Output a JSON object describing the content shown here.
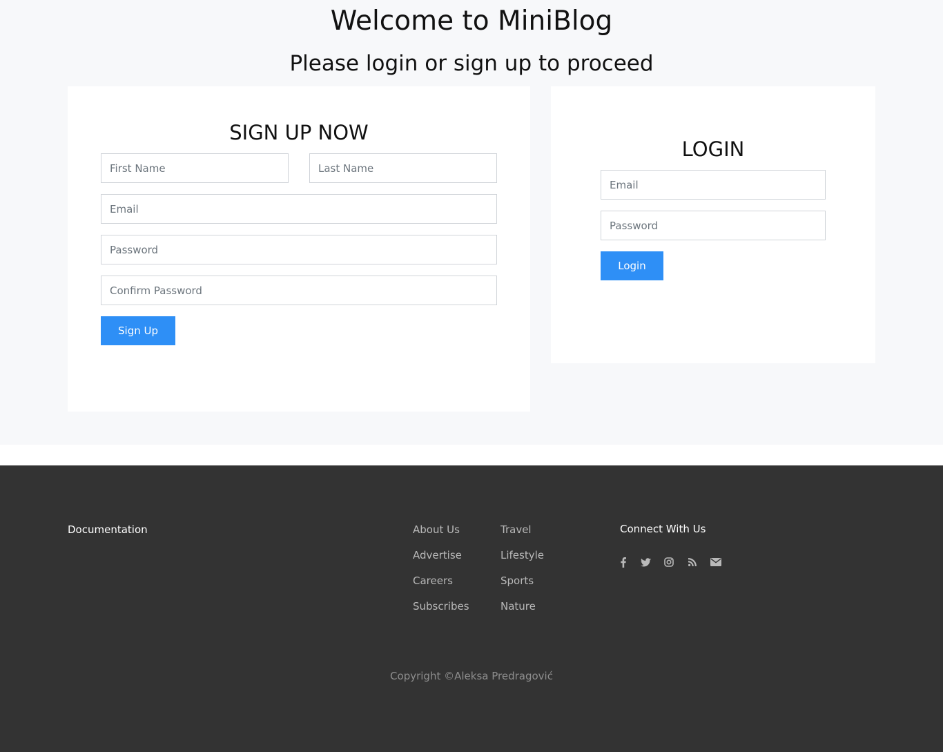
{
  "header": {
    "title": "Welcome to MiniBlog",
    "subtitle": "Please login or sign up to proceed"
  },
  "signup": {
    "title": "SIGN UP NOW",
    "first_name_placeholder": "First Name",
    "last_name_placeholder": "Last Name",
    "email_placeholder": "Email",
    "password_placeholder": "Password",
    "confirm_password_placeholder": "Confirm Password",
    "button_label": "Sign Up"
  },
  "login": {
    "title": "LOGIN",
    "email_placeholder": "Email",
    "password_placeholder": "Password",
    "button_label": "Login"
  },
  "footer": {
    "documentation_label": "Documentation",
    "links_col1": [
      "About Us",
      "Advertise",
      "Careers",
      "Subscribes"
    ],
    "links_col2": [
      "Travel",
      "Lifestyle",
      "Sports",
      "Nature"
    ],
    "connect_title": "Connect With Us",
    "social_icons": [
      "facebook-icon",
      "twitter-icon",
      "instagram-icon",
      "rss-icon",
      "envelope-icon"
    ],
    "copyright": "Copyright ©Aleksa Predragović"
  },
  "colors": {
    "accent": "#2e8ff6",
    "page_background": "#f7f8fa",
    "footer_background": "#333333"
  }
}
